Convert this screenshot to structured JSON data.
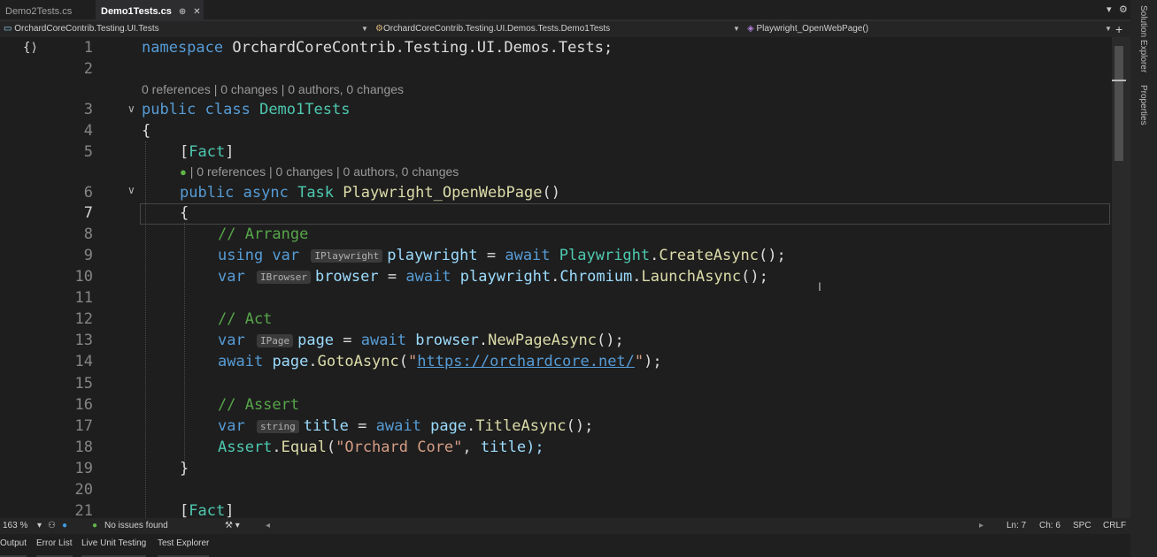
{
  "tabs": [
    {
      "label": "Demo2Tests.cs",
      "active": false
    },
    {
      "label": "Demo1Tests.cs",
      "active": true
    }
  ],
  "tab_pin_icon": "⊕",
  "tab_close_icon": "✕",
  "navbar": {
    "project": "OrchardCoreContrib.Testing.UI.Tests",
    "class": "OrchardCoreContrib.Testing.UI.Demos.Tests.Demo1Tests",
    "member": "Playwright_OpenWebPage()"
  },
  "side_panels": {
    "solution_explorer": "Solution Explorer",
    "properties": "Properties"
  },
  "codelens": {
    "class": "0 references | 0 changes | 0 authors, 0 changes",
    "method": "| 0 references | 0 changes | 0 authors, 0 changes"
  },
  "line_numbers": [
    "1",
    "2",
    "3",
    "4",
    "5",
    "6",
    "7",
    "8",
    "9",
    "10",
    "11",
    "12",
    "13",
    "14",
    "15",
    "16",
    "17",
    "18",
    "19",
    "20",
    "21"
  ],
  "code": {
    "l1_kw": "namespace",
    "l1_ns": "OrchardCoreContrib.Testing.UI.Demos.Tests;",
    "l3_kw": "public class",
    "l3_name": "Demo1Tests",
    "open_brace": "{",
    "close_brace": "}",
    "attr_open": "[",
    "attr_name": "Fact",
    "attr_close": "]",
    "l6_kw": "public async",
    "l6_type": "Task",
    "l6_method": "Playwright_OpenWebPage",
    "l6_paren": "()",
    "comment_arrange": "// Arrange",
    "using_var": "using var",
    "hint_iplaywright": "IPlaywright",
    "v_playwright": "playwright",
    "eq": "=",
    "await": "await",
    "t_playwright": "Playwright",
    "dot": ".",
    "m_createasync": "CreateAsync",
    "call_end": "();",
    "var": "var",
    "hint_ibrowser": "IBrowser",
    "v_browser": "browser",
    "p_chromium": "Chromium",
    "m_launchasync": "LaunchAsync",
    "comment_act": "// Act",
    "hint_ipage": "IPage",
    "v_page": "page",
    "m_newpageasync": "NewPageAsync",
    "m_gotoasync": "GotoAsync",
    "paren_open": "(",
    "quote": "\"",
    "url": "https://orchardcore.net/",
    "paren_close_semi": ");",
    "comment_assert": "// Assert",
    "hint_string": "string",
    "v_title": "title",
    "m_titleasync": "TitleAsync",
    "t_assert": "Assert",
    "m_equal": "Equal",
    "s_orchard": "\"Orchard Core\"",
    "comma": ",",
    "v_title_end": "title);"
  },
  "statusbar": {
    "zoom": "163 %",
    "issues": "No issues found",
    "ln": "Ln: 7",
    "ch": "Ch: 6",
    "spc": "SPC",
    "crlf": "CRLF"
  },
  "bottom_tabs": [
    "Output",
    "Error List",
    "Live Unit Testing",
    "Test Explorer"
  ]
}
